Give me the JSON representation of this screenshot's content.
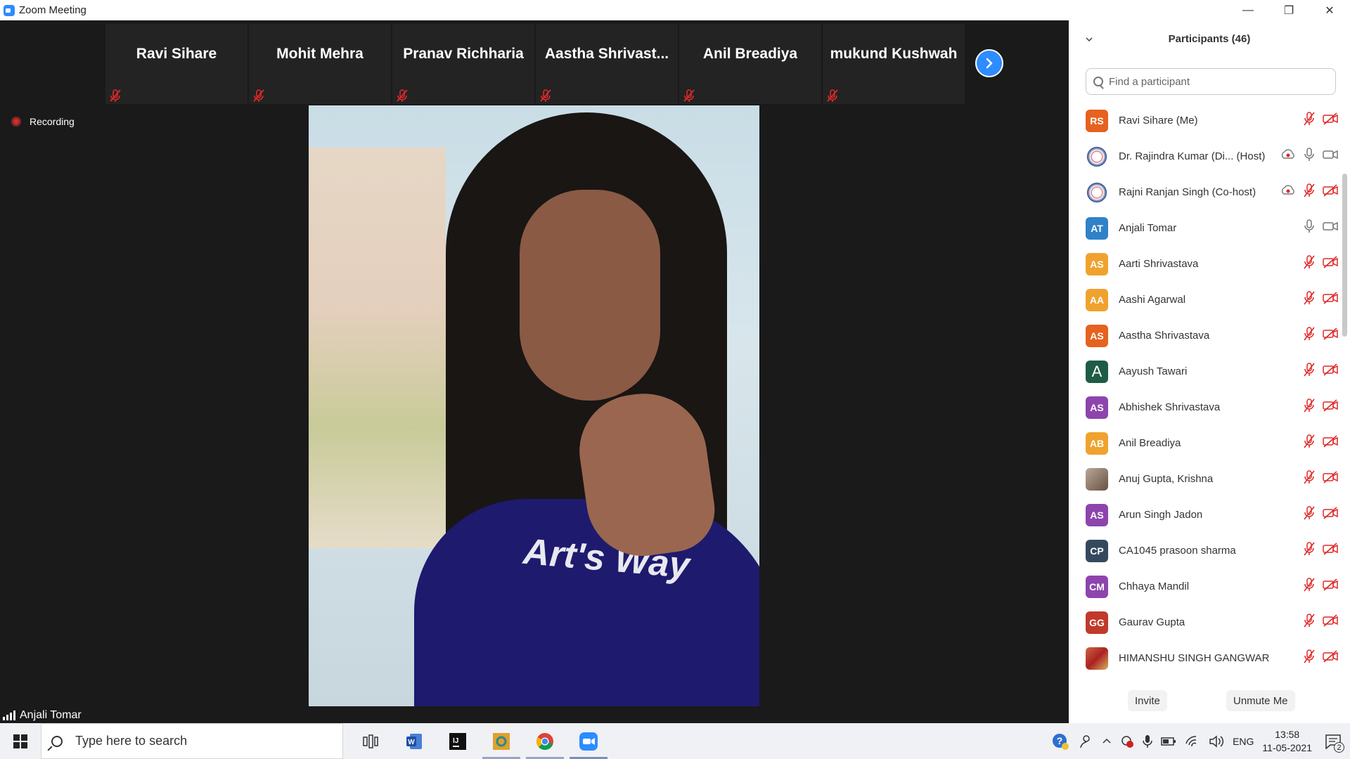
{
  "window": {
    "title": "Zoom Meeting",
    "minimize": "—",
    "restore": "❐",
    "close": "✕"
  },
  "thumbnails": [
    {
      "name": "Ravi Sihare"
    },
    {
      "name": "Mohit Mehra"
    },
    {
      "name": "Pranav Richharia"
    },
    {
      "name": "Aastha  Shrivast..."
    },
    {
      "name": "Anil Breadiya"
    },
    {
      "name": "mukund Kushwah"
    }
  ],
  "recording": {
    "label": "Recording"
  },
  "active_speaker": {
    "name": "Anjali Tomar"
  },
  "video": {
    "shirt_text": "Art's Way"
  },
  "panel": {
    "title": "Participants (46)",
    "search_placeholder": "Find a participant",
    "participants": [
      {
        "initials": "RS",
        "name": "Ravi Sihare (Me)",
        "color": "#e5621f",
        "mic": "muted",
        "video": "off"
      },
      {
        "initials": "",
        "name": "Dr. Rajindra Kumar (Di... (Host)",
        "color": "",
        "mic": "on",
        "video": "on",
        "recording": true
      },
      {
        "initials": "",
        "name": "Rajni Ranjan Singh (Co-host)",
        "color": "",
        "mic": "muted",
        "video": "off",
        "recording": true
      },
      {
        "initials": "AT",
        "name": "Anjali Tomar",
        "color": "#2f82c7",
        "mic": "on",
        "video": "on"
      },
      {
        "initials": "AS",
        "name": "Aarti Shrivastava",
        "color": "#f0a22e",
        "mic": "muted",
        "video": "off"
      },
      {
        "initials": "AA",
        "name": "Aashi Agarwal",
        "color": "#f0a22e",
        "mic": "muted",
        "video": "off"
      },
      {
        "initials": "AS",
        "name": "Aastha Shrivastava",
        "color": "#e5621f",
        "mic": "muted",
        "video": "off"
      },
      {
        "initials": "A",
        "name": "Aayush Tawari",
        "color": "#1f5c45",
        "mic": "muted",
        "video": "off"
      },
      {
        "initials": "AS",
        "name": "Abhishek Shrivastava",
        "color": "#8e44ad",
        "mic": "muted",
        "video": "off"
      },
      {
        "initials": "AB",
        "name": "Anil Breadiya",
        "color": "#f0a22e",
        "mic": "muted",
        "video": "off"
      },
      {
        "initials": "",
        "name": "Anuj Gupta, Krishna",
        "color": "",
        "mic": "muted",
        "video": "off"
      },
      {
        "initials": "AS",
        "name": "Arun Singh Jadon",
        "color": "#8e44ad",
        "mic": "muted",
        "video": "off"
      },
      {
        "initials": "CP",
        "name": "CA1045 prasoon sharma",
        "color": "#34495e",
        "mic": "muted",
        "video": "off"
      },
      {
        "initials": "CM",
        "name": "Chhaya Mandil",
        "color": "#8e44ad",
        "mic": "muted",
        "video": "off"
      },
      {
        "initials": "GG",
        "name": "Gaurav Gupta",
        "color": "#c0392b",
        "mic": "muted",
        "video": "off"
      },
      {
        "initials": "",
        "name": "HIMANSHU SINGH GANGWAR",
        "color": "",
        "mic": "muted",
        "video": "off"
      }
    ],
    "invite_label": "Invite",
    "unmute_label": "Unmute Me"
  },
  "taskbar": {
    "search_placeholder": "Type here to search",
    "language": "ENG",
    "time": "13:58",
    "date": "11-05-2021",
    "notification_count": "2"
  },
  "colors": {
    "accent": "#2d8cff",
    "muted_red": "#e02828"
  }
}
